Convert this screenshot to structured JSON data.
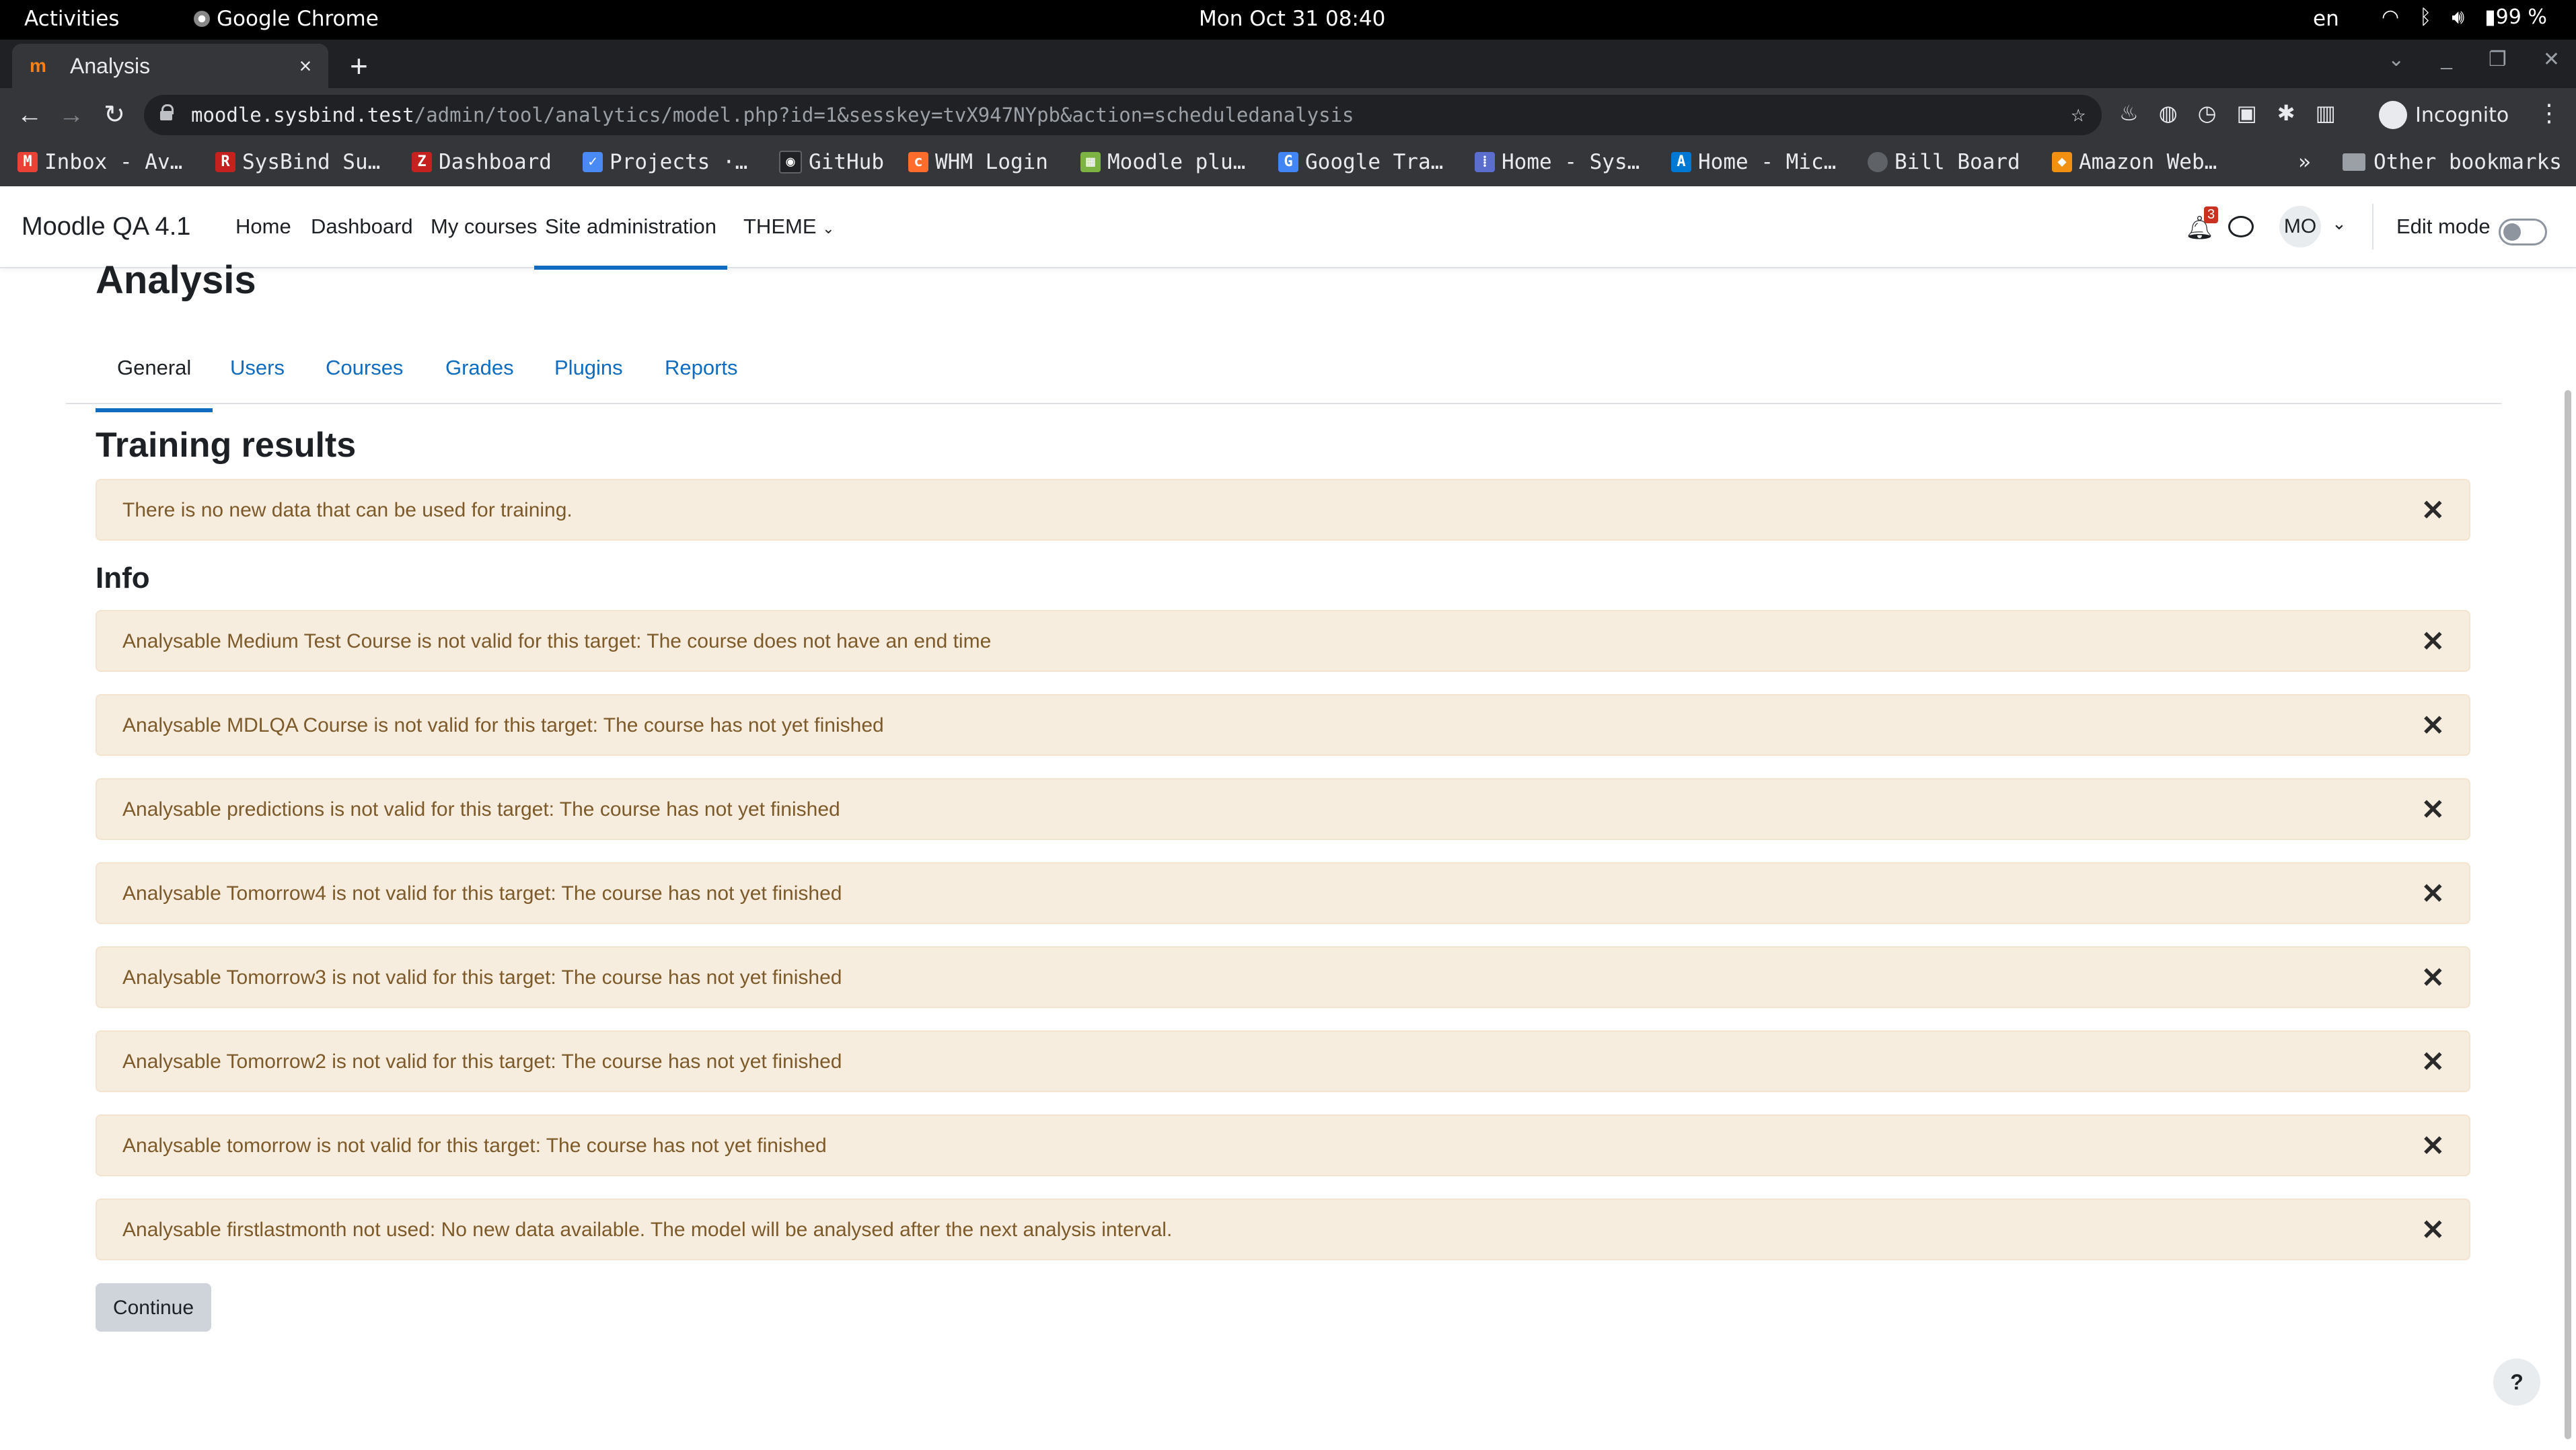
{
  "os_bar": {
    "activities": "Activities",
    "app_name": "Google Chrome",
    "clock": "Mon Oct 31  08:40",
    "lang": "en",
    "battery": "99 %"
  },
  "browser": {
    "tab_title": "Analysis",
    "url_host": "moodle.sysbind.test",
    "url_path": "/admin/tool/analytics/model.php?id=1&sesskey=tvX947NYpb&action=scheduledanalysis",
    "profile_label": "Incognito",
    "bookmarks": [
      {
        "label": "Inbox - Av…",
        "icon": "gmail-icon",
        "color": "#ea4335"
      },
      {
        "label": "SysBind Su…",
        "icon": "sysbind-icon",
        "color": "#c5221f"
      },
      {
        "label": "Dashboard",
        "icon": "zoho-icon",
        "color": "#c5221f"
      },
      {
        "label": "Projects ·…",
        "icon": "projects-icon",
        "color": "#4a8af4"
      },
      {
        "label": "GitHub",
        "icon": "github-icon",
        "color": "#202124"
      },
      {
        "label": "WHM Login",
        "icon": "whm-icon",
        "color": "#ff6c2c"
      },
      {
        "label": "Moodle plu…",
        "icon": "moodle-plugin-icon",
        "color": "#7cb342"
      },
      {
        "label": "Google Tra…",
        "icon": "google-translate-icon",
        "color": "#4285f4"
      },
      {
        "label": "Home - Sys…",
        "icon": "home-sys-icon",
        "color": "#5b6dcd"
      },
      {
        "label": "Home - Mic…",
        "icon": "azure-icon",
        "color": "#0078d4"
      },
      {
        "label": "Bill Board",
        "icon": "globe-icon",
        "color": "#5f6368"
      },
      {
        "label": "Amazon Web…",
        "icon": "aws-icon",
        "color": "#f29111"
      }
    ],
    "bookmarks_more": "»",
    "other_bookmarks": "Other bookmarks"
  },
  "moodle_nav": {
    "brand": "Moodle QA 4.1",
    "links": [
      "Home",
      "Dashboard",
      "My courses",
      "Site administration",
      "THEME"
    ],
    "active_link": "Site administration",
    "notification_count": "3",
    "avatar_initials": "MO",
    "edit_mode_label": "Edit mode"
  },
  "page": {
    "title": "Analysis",
    "tabs": [
      "General",
      "Users",
      "Courses",
      "Grades",
      "Plugins",
      "Reports"
    ],
    "active_tab": "General",
    "training_heading": "Training results",
    "training_alerts": [
      "There is no new data that can be used for training."
    ],
    "info_heading": "Info",
    "info_alerts": [
      "Analysable Medium Test Course is not valid for this target: The course does not have an end time",
      "Analysable MDLQA Course is not valid for this target: The course has not yet finished",
      "Analysable predictions is not valid for this target: The course has not yet finished",
      "Analysable Tomorrow4 is not valid for this target: The course has not yet finished",
      "Analysable Tomorrow3 is not valid for this target: The course has not yet finished",
      "Analysable Tomorrow2 is not valid for this target: The course has not yet finished",
      "Analysable tomorrow is not valid for this target: The course has not yet finished",
      "Analysable firstlastmonth not used: No new data available. The model will be analysed after the next analysis interval."
    ],
    "close_glyph": "✕",
    "continue_label": "Continue",
    "help_label": "?"
  },
  "colors": {
    "accent": "#0f6cbf",
    "alert_bg": "#f7eddf",
    "alert_text": "#7d5a29"
  }
}
